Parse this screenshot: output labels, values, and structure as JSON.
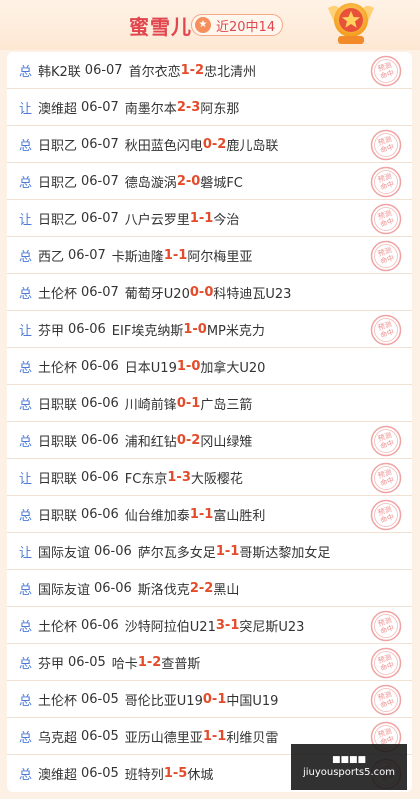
{
  "header": {
    "name": "蜜雪儿",
    "record": "近20中14",
    "badge_star": "★"
  },
  "stamp_text": [
    "预测",
    "命中"
  ],
  "ad": {
    "top_text": "■■■■",
    "url": "jiuyousports5.com"
  },
  "rows": [
    {
      "tag": "总",
      "league": "韩K2联",
      "date": "06-07",
      "home": "首尔衣恋",
      "hg": "1",
      "sep": " - ",
      "ag": "2",
      "away": "忠北清州",
      "hit": true
    },
    {
      "tag": "让",
      "league": "澳维超",
      "date": "06-07",
      "home": "南墨尔本",
      "hg": "2",
      "sep": " - ",
      "ag": "3",
      "away": "阿东那",
      "hit": false
    },
    {
      "tag": "总",
      "league": "日职乙",
      "date": "06-07",
      "home": "秋田蓝色闪电",
      "hg": "0",
      "sep": " - ",
      "ag": "2",
      "away": "鹿儿岛联",
      "hit": true
    },
    {
      "tag": "总",
      "league": "日职乙",
      "date": "06-07",
      "home": "德岛漩涡",
      "hg": "2",
      "sep": " - ",
      "ag": "0",
      "away": "磐城FC",
      "hit": true
    },
    {
      "tag": "让",
      "league": "日职乙",
      "date": "06-07",
      "home": "八户云罗里",
      "hg": "1",
      "sep": " - ",
      "ag": "1",
      "away": "今治",
      "hit": true
    },
    {
      "tag": "总",
      "league": "西乙",
      "date": "06-07",
      "home": "卡斯迪隆",
      "hg": "1",
      "sep": " - ",
      "ag": "1",
      "away": "阿尔梅里亚",
      "hit": true
    },
    {
      "tag": "总",
      "league": "土伦杯",
      "date": "06-07",
      "home": "葡萄牙U20",
      "hg": "0",
      "sep": " - ",
      "ag": "0",
      "away": "科特迪瓦U23",
      "hit": false
    },
    {
      "tag": "让",
      "league": "芬甲",
      "date": "06-06",
      "home": "EIF埃克纳斯",
      "hg": "1",
      "sep": " - ",
      "ag": "0",
      "away": "MP米克力",
      "hit": true
    },
    {
      "tag": "总",
      "league": "土伦杯",
      "date": "06-06",
      "home": "日本U19",
      "hg": "1",
      "sep": " - ",
      "ag": "0",
      "away": "加拿大U20",
      "hit": false
    },
    {
      "tag": "总",
      "league": "日职联",
      "date": "06-06",
      "home": "川崎前锋",
      "hg": "0",
      "sep": " - ",
      "ag": "1",
      "away": "广岛三箭",
      "hit": false
    },
    {
      "tag": "总",
      "league": "日职联",
      "date": "06-06",
      "home": "浦和红钻",
      "hg": "0",
      "sep": " - ",
      "ag": "2",
      "away": "冈山绿雉",
      "hit": true
    },
    {
      "tag": "让",
      "league": "日职联",
      "date": "06-06",
      "home": "FC东京",
      "hg": "1",
      "sep": " - ",
      "ag": "3",
      "away": "大阪樱花",
      "hit": true
    },
    {
      "tag": "总",
      "league": "日职联",
      "date": "06-06",
      "home": "仙台维加泰",
      "hg": "1",
      "sep": " - ",
      "ag": "1",
      "away": "富山胜利",
      "hit": true
    },
    {
      "tag": "让",
      "league": "国际友谊",
      "date": "06-06",
      "home": "萨尔瓦多女足",
      "hg": "1",
      "sep": " - ",
      "ag": "1",
      "away": "哥斯达黎加女足",
      "hit": false
    },
    {
      "tag": "总",
      "league": "国际友谊",
      "date": "06-06",
      "home": "斯洛伐克",
      "hg": "2",
      "sep": " - ",
      "ag": "2",
      "away": "黑山",
      "hit": false
    },
    {
      "tag": "总",
      "league": "土伦杯",
      "date": "06-06",
      "home": "沙特阿拉伯U21",
      "hg": "3",
      "sep": " - ",
      "ag": "1",
      "away": "突尼斯U23",
      "hit": true
    },
    {
      "tag": "总",
      "league": "芬甲",
      "date": "06-05",
      "home": "哈卡",
      "hg": "1",
      "sep": " - ",
      "ag": "2",
      "away": "查普斯",
      "hit": true
    },
    {
      "tag": "总",
      "league": "土伦杯",
      "date": "06-05",
      "home": "哥伦比亚U19",
      "hg": "0",
      "sep": " - ",
      "ag": "1",
      "away": "中国U19",
      "hit": true
    },
    {
      "tag": "总",
      "league": "乌克超",
      "date": "06-05",
      "home": "亚历山德里亚",
      "hg": "1",
      "sep": " - ",
      "ag": "1",
      "away": "利维贝雷",
      "hit": true
    },
    {
      "tag": "总",
      "league": "澳维超",
      "date": "06-05",
      "home": "班特列",
      "hg": "1",
      "sep": " - ",
      "ag": "5",
      "away": "休城",
      "hit": true
    }
  ]
}
